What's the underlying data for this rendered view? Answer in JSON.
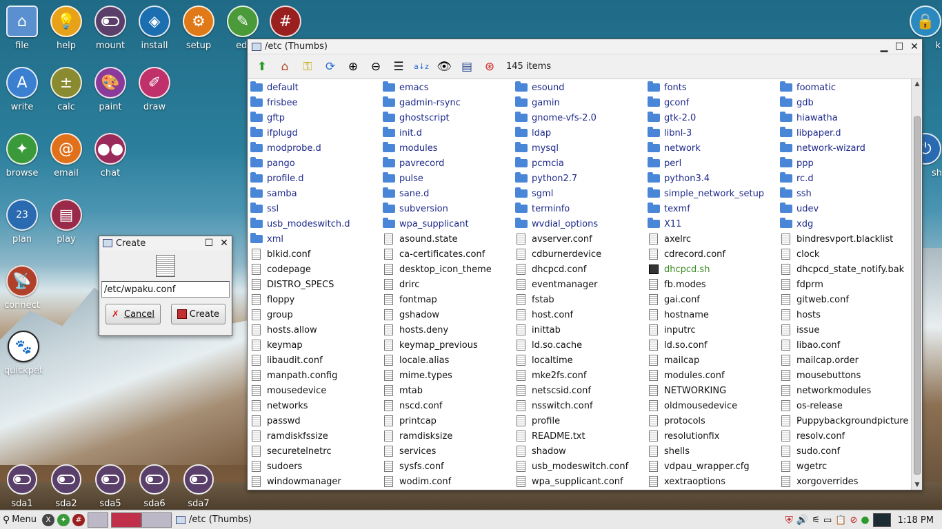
{
  "desktop": {
    "icons": [
      {
        "label": "file",
        "icon": "home-folder-icon",
        "color": "#5a8fd0"
      },
      {
        "label": "help",
        "icon": "lightbulb-icon",
        "color": "#e8a21a"
      },
      {
        "label": "mount",
        "icon": "toggle-icon",
        "color": "#5a3f6a"
      },
      {
        "label": "install",
        "icon": "dropbox-icon",
        "color": "#1b6fb0"
      },
      {
        "label": "setup",
        "icon": "gear-icon",
        "color": "#e07a18"
      },
      {
        "label": "edi",
        "icon": "edit-icon",
        "color": "#4a9a3a"
      },
      {
        "label": "",
        "icon": "hash-icon",
        "color": "#9a2020"
      },
      {
        "label": "write",
        "icon": "write-icon",
        "color": "#3a7fd0"
      },
      {
        "label": "calc",
        "icon": "calculator-icon",
        "color": "#8a8a30"
      },
      {
        "label": "paint",
        "icon": "palette-icon",
        "color": "#8a3a9a"
      },
      {
        "label": "draw",
        "icon": "draw-icon",
        "color": "#c0306a"
      },
      {
        "label": "browse",
        "icon": "compass-icon",
        "color": "#3a9a3a"
      },
      {
        "label": "email",
        "icon": "at-icon",
        "color": "#e0701a"
      },
      {
        "label": "chat",
        "icon": "chat-icon",
        "color": "#9a2a5a"
      },
      {
        "label": "plan",
        "icon": "calendar-icon",
        "color": "#2a6ab0"
      },
      {
        "label": "play",
        "icon": "clapper-icon",
        "color": "#9a2a4a"
      },
      {
        "label": "connect",
        "icon": "satellite-icon",
        "color": "#b0402a"
      },
      {
        "label": "quickpet",
        "icon": "pet-icon",
        "color": "#222222"
      }
    ],
    "calendar_day": "23",
    "drives": [
      "sda1",
      "sda2",
      "sda5",
      "sda6",
      "sda7"
    ],
    "right_edge_labels": [
      "k",
      "sh"
    ]
  },
  "window": {
    "title": "/etc (Thumbs)",
    "item_count": "145 items",
    "toolbar_icons": [
      "up-arrow-icon",
      "home-icon",
      "key-icon",
      "refresh-icon",
      "zoom-in-icon",
      "zoom-out-icon",
      "list-icon",
      "sort-az-icon",
      "eye-icon",
      "details-icon",
      "help-lifebuoy-icon"
    ],
    "files": [
      [
        "default",
        "dir"
      ],
      [
        "emacs",
        "dir"
      ],
      [
        "esound",
        "dir"
      ],
      [
        "fonts",
        "dir"
      ],
      [
        "foomatic",
        "dir"
      ],
      [
        "frisbee",
        "dir"
      ],
      [
        "gadmin-rsync",
        "dir"
      ],
      [
        "gamin",
        "dir"
      ],
      [
        "gconf",
        "dir"
      ],
      [
        "gdb",
        "dir"
      ],
      [
        "gftp",
        "dir"
      ],
      [
        "ghostscript",
        "dir"
      ],
      [
        "gnome-vfs-2.0",
        "dir"
      ],
      [
        "gtk-2.0",
        "dir"
      ],
      [
        "hiawatha",
        "dir"
      ],
      [
        "ifplugd",
        "dir"
      ],
      [
        "init.d",
        "dir"
      ],
      [
        "ldap",
        "dir"
      ],
      [
        "libnl-3",
        "dir"
      ],
      [
        "libpaper.d",
        "dir"
      ],
      [
        "modprobe.d",
        "dir"
      ],
      [
        "modules",
        "dir"
      ],
      [
        "mysql",
        "dir"
      ],
      [
        "network",
        "dir"
      ],
      [
        "network-wizard",
        "dir"
      ],
      [
        "pango",
        "dir"
      ],
      [
        "pavrecord",
        "dir"
      ],
      [
        "pcmcia",
        "dir"
      ],
      [
        "perl",
        "dir"
      ],
      [
        "ppp",
        "dir"
      ],
      [
        "profile.d",
        "dir"
      ],
      [
        "pulse",
        "dir"
      ],
      [
        "python2.7",
        "dir"
      ],
      [
        "python3.4",
        "dir"
      ],
      [
        "rc.d",
        "dir"
      ],
      [
        "samba",
        "dir"
      ],
      [
        "sane.d",
        "dir"
      ],
      [
        "sgml",
        "dir"
      ],
      [
        "simple_network_setup",
        "dir"
      ],
      [
        "ssh",
        "dir"
      ],
      [
        "ssl",
        "dir"
      ],
      [
        "subversion",
        "dir"
      ],
      [
        "terminfo",
        "dir"
      ],
      [
        "texmf",
        "dir"
      ],
      [
        "udev",
        "dir"
      ],
      [
        "usb_modeswitch.d",
        "dir"
      ],
      [
        "wpa_supplicant",
        "dir"
      ],
      [
        "wvdial_options",
        "dir"
      ],
      [
        "X11",
        "dir"
      ],
      [
        "xdg",
        "dir"
      ],
      [
        "xml",
        "dir"
      ],
      [
        "asound.state",
        "file"
      ],
      [
        "avserver.conf",
        "file"
      ],
      [
        "axelrc",
        "file"
      ],
      [
        "bindresvport.blacklist",
        "file"
      ],
      [
        "blkid.conf",
        "file"
      ],
      [
        "ca-certificates.conf",
        "file"
      ],
      [
        "cdburnerdevice",
        "file"
      ],
      [
        "cdrecord.conf",
        "file"
      ],
      [
        "clock",
        "file"
      ],
      [
        "codepage",
        "file"
      ],
      [
        "desktop_icon_theme",
        "file"
      ],
      [
        "dhcpcd.conf",
        "file"
      ],
      [
        "dhcpcd.sh",
        "sh"
      ],
      [
        "dhcpcd_state_notify.bak",
        "file"
      ],
      [
        "DISTRO_SPECS",
        "file"
      ],
      [
        "drirc",
        "file"
      ],
      [
        "eventmanager",
        "file"
      ],
      [
        "fb.modes",
        "file"
      ],
      [
        "fdprm",
        "file"
      ],
      [
        "floppy",
        "file"
      ],
      [
        "fontmap",
        "file"
      ],
      [
        "fstab",
        "file"
      ],
      [
        "gai.conf",
        "file"
      ],
      [
        "gitweb.conf",
        "file"
      ],
      [
        "group",
        "file"
      ],
      [
        "gshadow",
        "file"
      ],
      [
        "host.conf",
        "file"
      ],
      [
        "hostname",
        "file"
      ],
      [
        "hosts",
        "file"
      ],
      [
        "hosts.allow",
        "file"
      ],
      [
        "hosts.deny",
        "file"
      ],
      [
        "inittab",
        "file"
      ],
      [
        "inputrc",
        "file"
      ],
      [
        "issue",
        "file"
      ],
      [
        "keymap",
        "file"
      ],
      [
        "keymap_previous",
        "file"
      ],
      [
        "ld.so.cache",
        "file"
      ],
      [
        "ld.so.conf",
        "file"
      ],
      [
        "libao.conf",
        "file"
      ],
      [
        "libaudit.conf",
        "file"
      ],
      [
        "locale.alias",
        "file"
      ],
      [
        "localtime",
        "file"
      ],
      [
        "mailcap",
        "file"
      ],
      [
        "mailcap.order",
        "file"
      ],
      [
        "manpath.config",
        "file"
      ],
      [
        "mime.types",
        "file"
      ],
      [
        "mke2fs.conf",
        "file"
      ],
      [
        "modules.conf",
        "file"
      ],
      [
        "mousebuttons",
        "file"
      ],
      [
        "mousedevice",
        "file"
      ],
      [
        "mtab",
        "file"
      ],
      [
        "netscsid.conf",
        "file"
      ],
      [
        "NETWORKING",
        "file"
      ],
      [
        "networkmodules",
        "file"
      ],
      [
        "networks",
        "file"
      ],
      [
        "nscd.conf",
        "file"
      ],
      [
        "nsswitch.conf",
        "file"
      ],
      [
        "oldmousedevice",
        "file"
      ],
      [
        "os-release",
        "file"
      ],
      [
        "passwd",
        "file"
      ],
      [
        "printcap",
        "file"
      ],
      [
        "profile",
        "file"
      ],
      [
        "protocols",
        "file"
      ],
      [
        "Puppybackgroundpicture",
        "file"
      ],
      [
        "ramdiskfssize",
        "file"
      ],
      [
        "ramdisksize",
        "file"
      ],
      [
        "README.txt",
        "file"
      ],
      [
        "resolutionfix",
        "file"
      ],
      [
        "resolv.conf",
        "file"
      ],
      [
        "securetelnetrc",
        "file"
      ],
      [
        "services",
        "file"
      ],
      [
        "shadow",
        "file"
      ],
      [
        "shells",
        "file"
      ],
      [
        "sudo.conf",
        "file"
      ],
      [
        "sudoers",
        "file"
      ],
      [
        "sysfs.conf",
        "file"
      ],
      [
        "usb_modeswitch.conf",
        "file"
      ],
      [
        "vdpau_wrapper.cfg",
        "file"
      ],
      [
        "wgetrc",
        "file"
      ],
      [
        "windowmanager",
        "file"
      ],
      [
        "wodim.conf",
        "file"
      ],
      [
        "wpa_supplicant.conf",
        "file"
      ],
      [
        "xextraoptions",
        "file"
      ],
      [
        "xorgoverrides",
        "file"
      ]
    ]
  },
  "dialog": {
    "title": "Create",
    "filename_value": "/etc/wpaku.conf",
    "cancel_label": "Cancel",
    "create_label": "Create"
  },
  "taskbar": {
    "menu_label": "Menu",
    "task_label": "/etc (Thumbs)",
    "clock": "1:18 PM"
  }
}
